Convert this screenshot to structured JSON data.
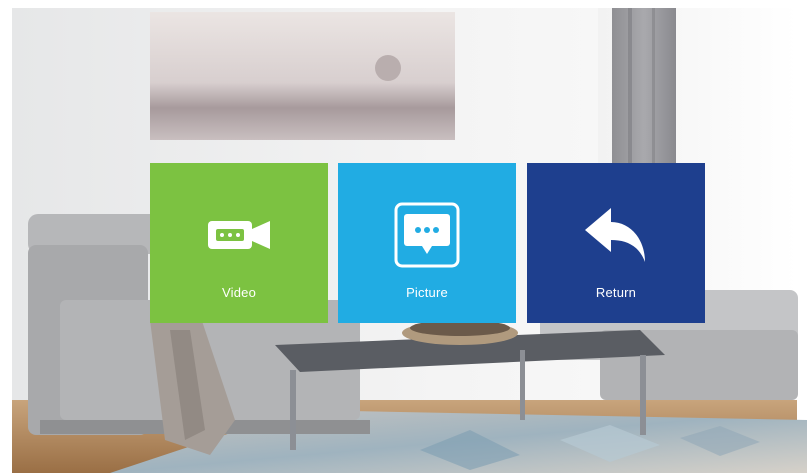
{
  "menu": {
    "tiles": [
      {
        "label": "Video",
        "icon": "video-camera-icon",
        "color": "#7cc241"
      },
      {
        "label": "Picture",
        "icon": "picture-message-icon",
        "color": "#21ace3"
      },
      {
        "label": "Return",
        "icon": "return-arrow-icon",
        "color": "#1e3f8e"
      }
    ]
  }
}
